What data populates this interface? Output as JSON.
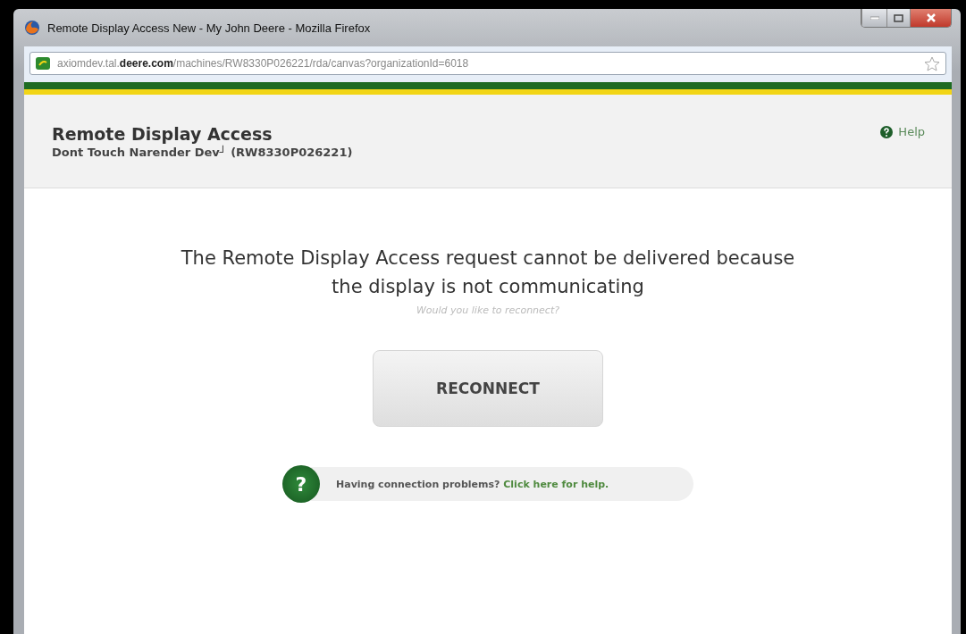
{
  "window": {
    "title": "Remote Display Access New - My John Deere - Mozilla Firefox"
  },
  "address_bar": {
    "url": "axiomdev.tal.**deere.com**/machines/RW8330P026221/rda/canvas?organizationId=6018"
  },
  "header": {
    "title": "Remote Display Access",
    "subtitle": "Dont Touch Narender Dev┘ (RW8330P026221)",
    "help": "Help"
  },
  "message": {
    "line_1": "The Remote Display Access request cannot be delivered because",
    "line_2": "the display is not communicating",
    "hint": "Would you like to reconnect?"
  },
  "button": {
    "label": "RECONNECT"
  },
  "help_bar": {
    "badge": "?",
    "text": "Having connection problems?",
    "link": "Click here for help."
  }
}
